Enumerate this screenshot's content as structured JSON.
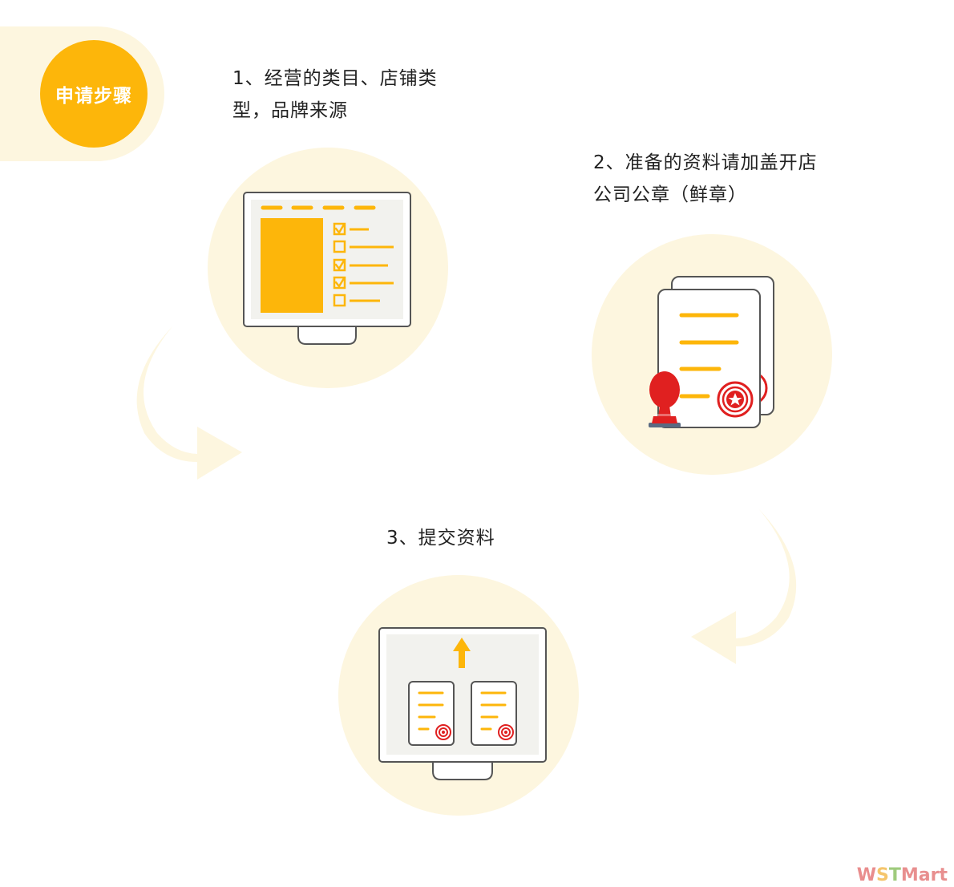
{
  "title": "申请步骤",
  "steps": [
    {
      "line1": "1、经营的类目、店铺类",
      "line2": "型，品牌来源"
    },
    {
      "line1": "2、准备的资料请加盖开店",
      "line2": "公司公章（鲜章）"
    },
    {
      "line1": "3、提交资料"
    }
  ],
  "watermark": {
    "w": "W",
    "s": "S",
    "t": "T",
    "rest": "Mart"
  },
  "colors": {
    "accent": "#fdb60a",
    "circle_bg": "#fdf6df",
    "stamp_red": "#e02020",
    "outline": "#555555"
  }
}
